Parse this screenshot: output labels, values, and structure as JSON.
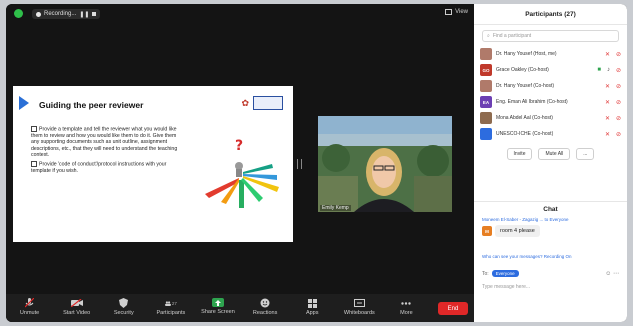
{
  "topbar": {
    "recording_label": "Recording...",
    "view_label": "View"
  },
  "slide": {
    "title": "Guiding the peer reviewer",
    "bullets": [
      "Provide a template and tell the reviewer what you would like them to review and how you would like them to do it. Give them any supporting documents such as unit outline, assignment descriptions, etc., that they will need to understand the teaching context.",
      "Provide 'code of conduct'/protocol instructions with your template if you wish."
    ]
  },
  "video": {
    "name_label": "Emily Kemp"
  },
  "toolbar": {
    "items": [
      {
        "label": "Unmute",
        "icon": "mic-muted-icon"
      },
      {
        "label": "Start Video",
        "icon": "video-off-icon"
      },
      {
        "label": "Security",
        "icon": "shield-icon"
      },
      {
        "label": "Participants",
        "icon": "participants-icon",
        "count": "27"
      },
      {
        "label": "Share Screen",
        "icon": "share-screen-icon"
      },
      {
        "label": "Reactions",
        "icon": "reactions-icon"
      },
      {
        "label": "Apps",
        "icon": "apps-icon"
      },
      {
        "label": "Whiteboards",
        "icon": "whiteboard-icon"
      },
      {
        "label": "More",
        "icon": "more-icon"
      }
    ],
    "end_label": "End"
  },
  "participants": {
    "title": "Participants (27)",
    "search_placeholder": "Find a participant",
    "list": [
      {
        "name": "Dr. Hany Yousef (Host, me)",
        "avatar_color": "#b07a6a",
        "initials": ""
      },
      {
        "name": "Grace Oakley (Co-host)",
        "avatar_color": "#c0392b",
        "initials": "GO"
      },
      {
        "name": "Dr. Hany Yousef (Co-host)",
        "avatar_color": "#b07a6a",
        "initials": ""
      },
      {
        "name": "Eng. Eman Ali Ibrahim (Co-host)",
        "avatar_color": "#6c3fb3",
        "initials": "EA"
      },
      {
        "name": "Mona Abdel Aal (Co-host)",
        "avatar_color": "#8e6b4f",
        "initials": ""
      },
      {
        "name": "UNESCO-ICHE (Co-host)",
        "avatar_color": "#2d6cdf",
        "initials": ""
      }
    ],
    "invite_label": "Invite",
    "mute_all_label": "Mute All",
    "more_label": "..."
  },
  "chat": {
    "title": "Chat",
    "from_label": "Moneem El-Saber - Zagazig ... to Everyone",
    "message": "room 4 please",
    "sender_initial": "M",
    "who_label": "Who can see your messages? Recording On",
    "to_label": "To:",
    "to_target": "Everyone",
    "placeholder": "Type message here..."
  },
  "colors": {
    "end_red": "#e02828",
    "share_green": "#2ea44f",
    "accent_blue": "#2d6cdf"
  }
}
